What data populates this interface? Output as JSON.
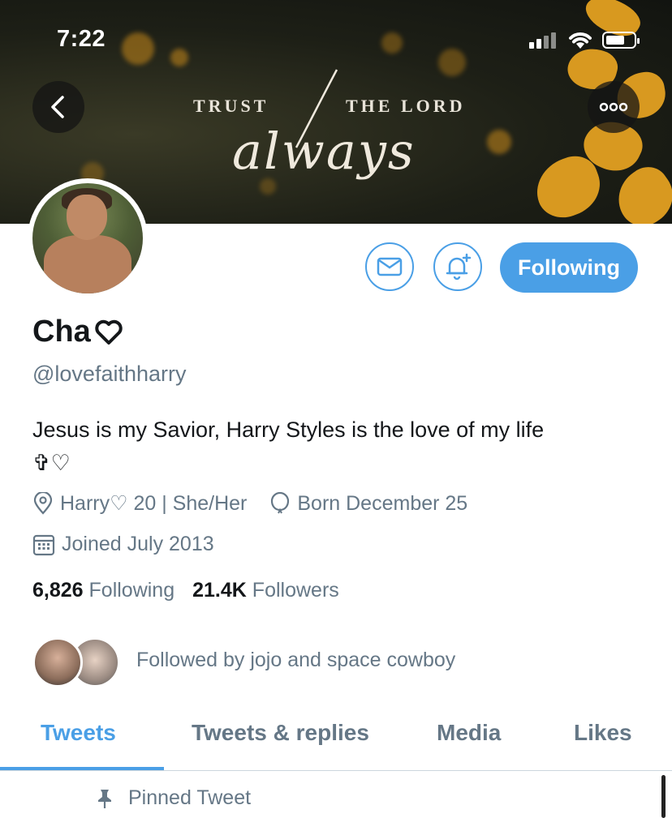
{
  "status_bar": {
    "time": "7:22"
  },
  "banner": {
    "text_left": "TRUST",
    "text_right": "THE LORD",
    "script_text": "always"
  },
  "profile": {
    "display_name": "Cha",
    "handle": "@lovefaithharry",
    "bio_line1": "Jesus is my Savior, Harry Styles is the love of my life",
    "bio_line2": "✞♡",
    "location": "Harry♡ 20 | She/Her",
    "birthday": "Born December 25",
    "joined": "Joined July 2013"
  },
  "actions": {
    "following_label": "Following"
  },
  "stats": {
    "following_count": "6,826",
    "following_label": "Following",
    "followers_count": "21.4K",
    "followers_label": "Followers"
  },
  "followed_by": "Followed by jojo and space cowboy",
  "tabs": [
    {
      "label": "Tweets"
    },
    {
      "label": "Tweets & replies"
    },
    {
      "label": "Media"
    },
    {
      "label": "Likes"
    }
  ],
  "pinned_label": "Pinned Tweet",
  "colors": {
    "accent": "#4a9fe6",
    "secondary_text": "#657786",
    "primary_text": "#14171a"
  },
  "icons": [
    "back-arrow-icon",
    "more-icon",
    "mail-icon",
    "bell-plus-icon",
    "heart-icon",
    "location-icon",
    "balloon-icon",
    "calendar-icon",
    "pin-icon"
  ]
}
